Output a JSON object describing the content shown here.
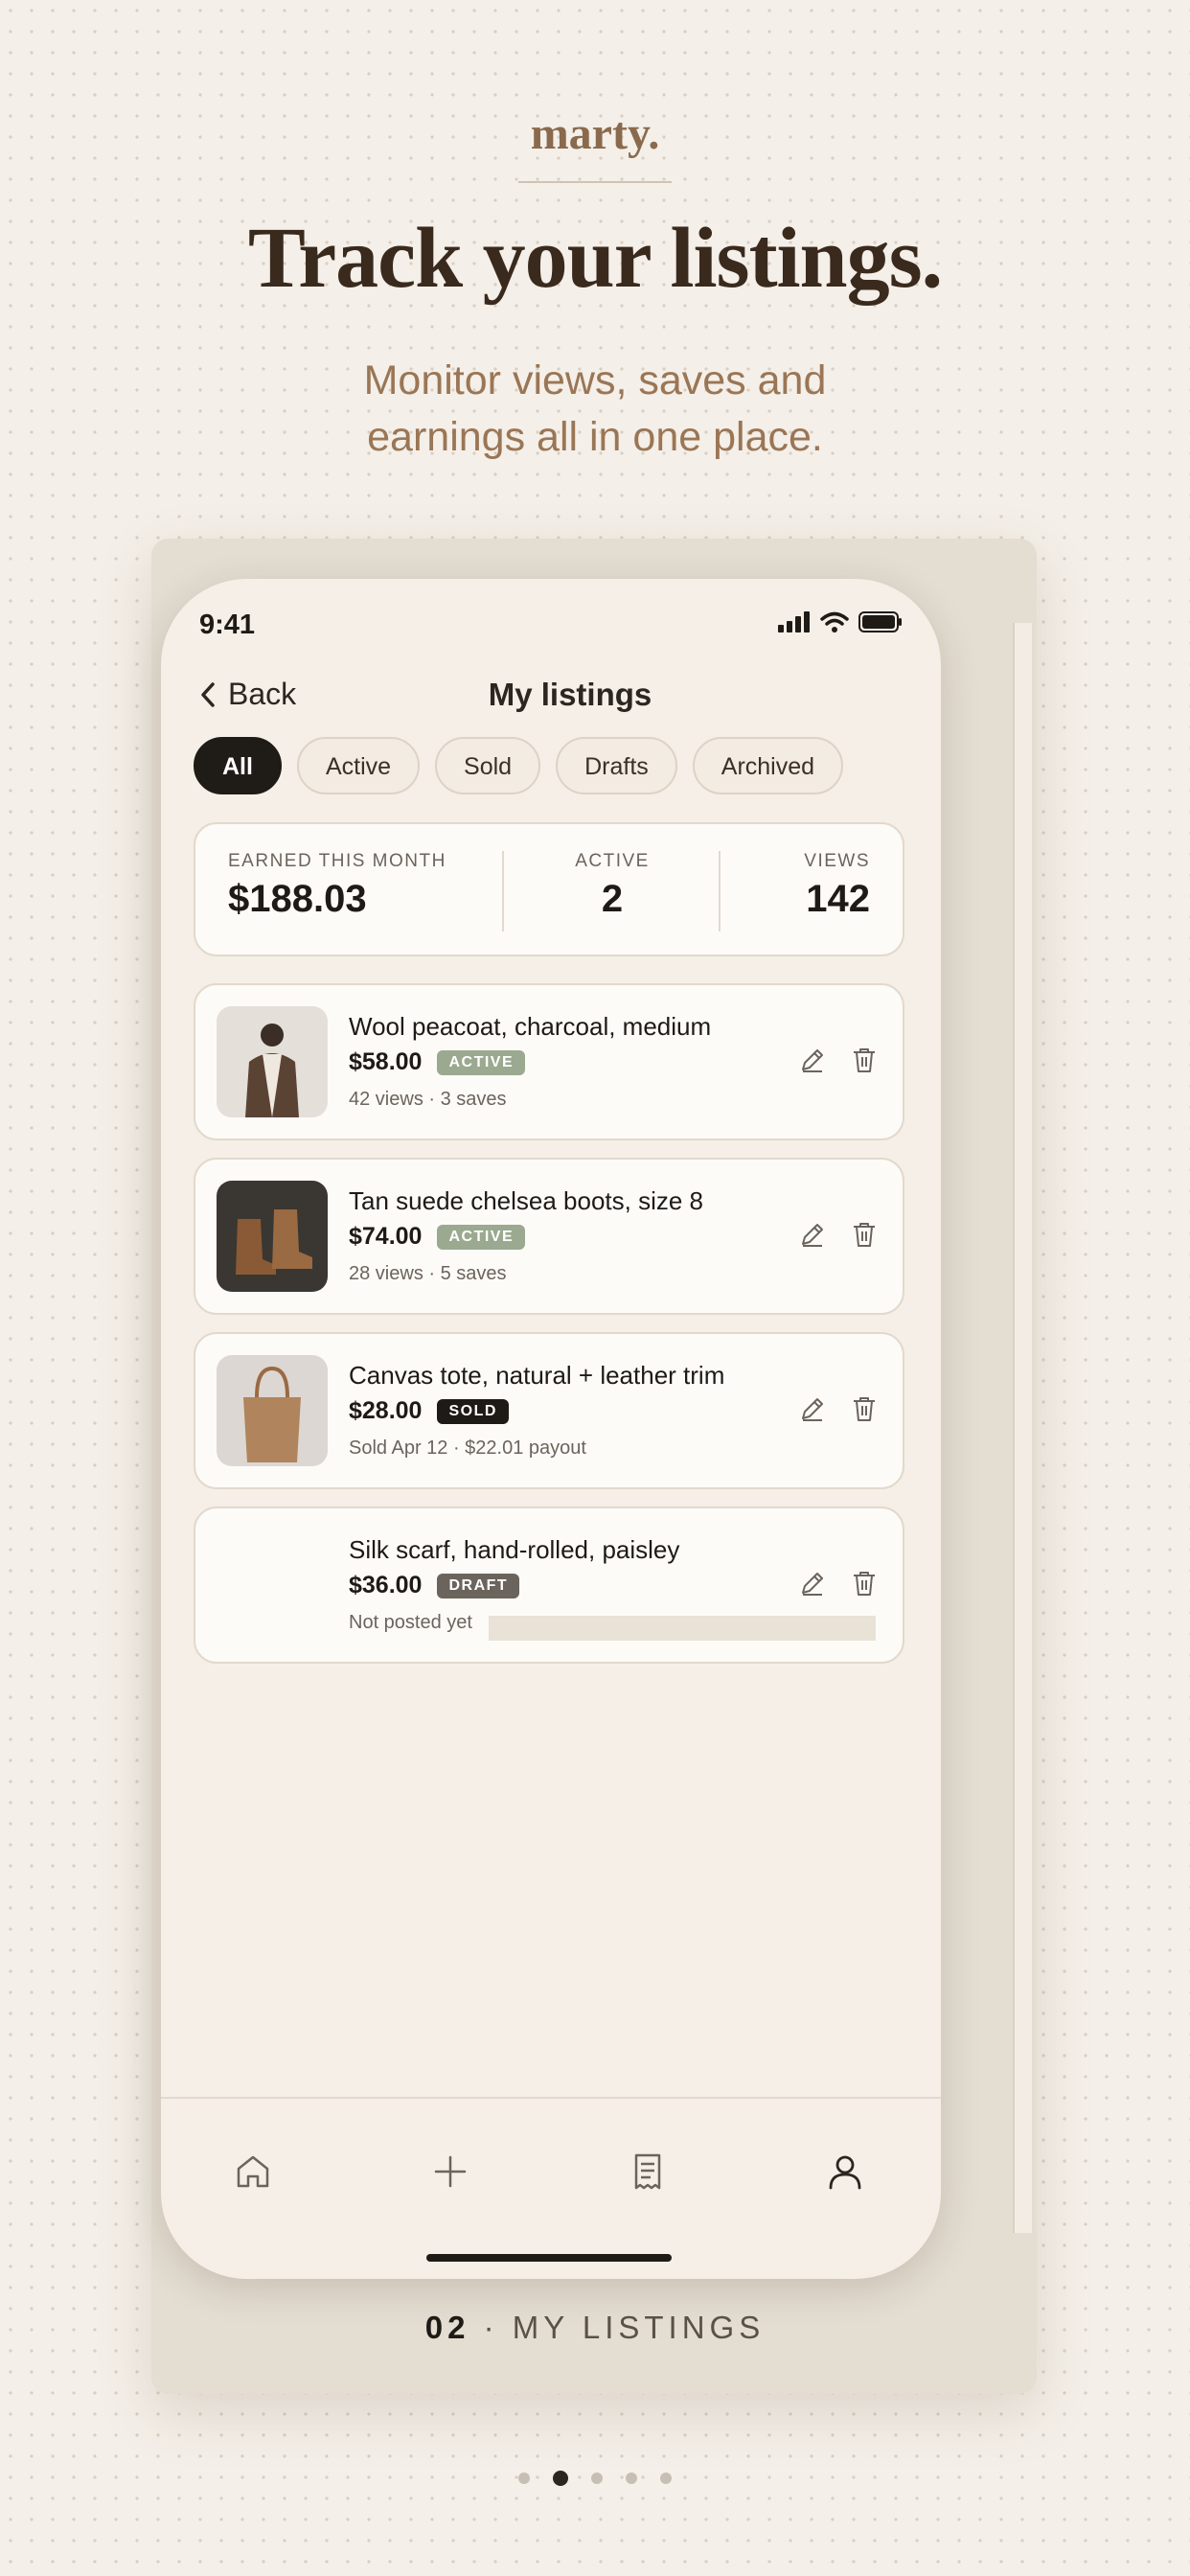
{
  "brand": "marty.",
  "headline": "Track your listings.",
  "subline": "Monitor views, saves and earnings all in one place.",
  "status": {
    "time": "9:41",
    "icons": [
      "signal-icon",
      "wifi-icon",
      "battery-icon"
    ]
  },
  "nav": {
    "back_label": "Back",
    "title": "My listings"
  },
  "filters": [
    {
      "label": "All",
      "selected": true
    },
    {
      "label": "Active",
      "selected": false
    },
    {
      "label": "Sold",
      "selected": false
    },
    {
      "label": "Drafts",
      "selected": false
    },
    {
      "label": "Archived",
      "selected": false
    }
  ],
  "stats": {
    "earned": {
      "label": "EARNED THIS MONTH",
      "value": "$188.03"
    },
    "active": {
      "label": "ACTIVE",
      "value": "2"
    },
    "views": {
      "label": "VIEWS",
      "value": "142"
    }
  },
  "listings": [
    {
      "title": "Wool peacoat, charcoal, medium",
      "price": "$58.00",
      "status": "ACTIVE",
      "meta": "42 views · 3 saves",
      "thumb": "coat-photo"
    },
    {
      "title": "Tan suede chelsea boots, size 8",
      "price": "$74.00",
      "status": "ACTIVE",
      "meta": "28 views · 5 saves",
      "thumb": "boots-photo"
    },
    {
      "title": "Canvas tote, natural + leather trim",
      "price": "$28.00",
      "status": "SOLD",
      "meta": "Sold Apr 12 · $22.01 payout",
      "thumb": "tote-photo"
    },
    {
      "title": "Silk scarf, hand-rolled, paisley",
      "price": "$36.00",
      "status": "DRAFT",
      "meta": "Not posted yet",
      "thumb": "none"
    }
  ],
  "tabbar": [
    "home-icon",
    "plus-icon",
    "receipt-icon",
    "profile-icon"
  ],
  "caption": {
    "number": "02",
    "separator": "·",
    "label": "MY LISTINGS"
  },
  "pagination": {
    "count": 5,
    "active_index": 1
  },
  "colors": {
    "active_badge": "#9aa98f",
    "sold_badge": "#1e1a16",
    "draft_badge": "#6b645c",
    "accent": "#8a6a4d"
  }
}
